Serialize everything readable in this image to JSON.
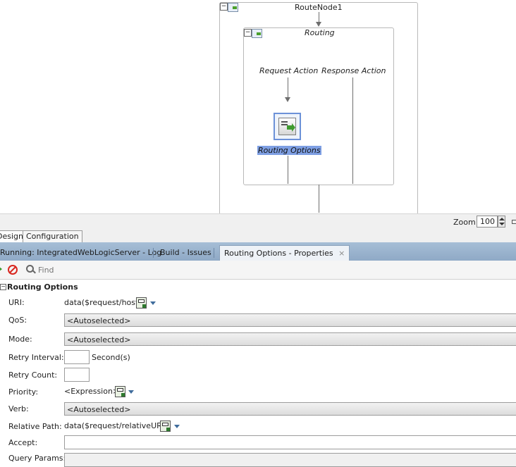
{
  "canvas": {
    "route_node_title": "RouteNode1",
    "routing_title": "Routing",
    "request_action": "Request Action",
    "response_action": "Response Action",
    "routing_options_label": "Routing Options",
    "collapse_glyph": "−"
  },
  "zoom": {
    "label": "Zoom:",
    "value": "100"
  },
  "editor_tabs": [
    "Design",
    "Configuration"
  ],
  "log_tabs": [
    {
      "label": "Running: IntegratedWebLogicServer - Log"
    },
    {
      "label": "Build - Issues"
    },
    {
      "label": "Routing Options - Properties",
      "active": true
    }
  ],
  "toolbar": {
    "find_placeholder": "Find"
  },
  "properties": {
    "section_title": "Routing Options",
    "uri": {
      "label": "URI:",
      "value": "data($request/host)"
    },
    "qos": {
      "label": "QoS:",
      "value": "<Autoselected>"
    },
    "mode": {
      "label": "Mode:",
      "value": "<Autoselected>"
    },
    "retry_interval": {
      "label": "Retry Interval:",
      "value": "",
      "unit": "Second(s)"
    },
    "retry_count": {
      "label": "Retry Count:",
      "value": ""
    },
    "priority": {
      "label": "Priority:",
      "value": "<Expression>"
    },
    "verb": {
      "label": "Verb:",
      "value": "<Autoselected>"
    },
    "relative_path": {
      "label": "Relative Path:",
      "value": "data($request/relativeURL)"
    },
    "accept": {
      "label": "Accept:",
      "value": ""
    },
    "query_params": {
      "label": "Query Params:"
    }
  },
  "colors": {
    "tab_strip": "#9fb8d2",
    "selection": "#7e9fe3",
    "stop_icon": "#d8261e",
    "run_icon": "#3c9a2e"
  },
  "icons": [
    "collapse-icon",
    "route-node-icon",
    "routing-icon",
    "routing-options-action-icon",
    "zoom-spinner-icon",
    "pin-icon",
    "close-icon",
    "run-icon",
    "stop-icon",
    "search-icon",
    "expression-builder-icon",
    "chevron-down-icon"
  ]
}
